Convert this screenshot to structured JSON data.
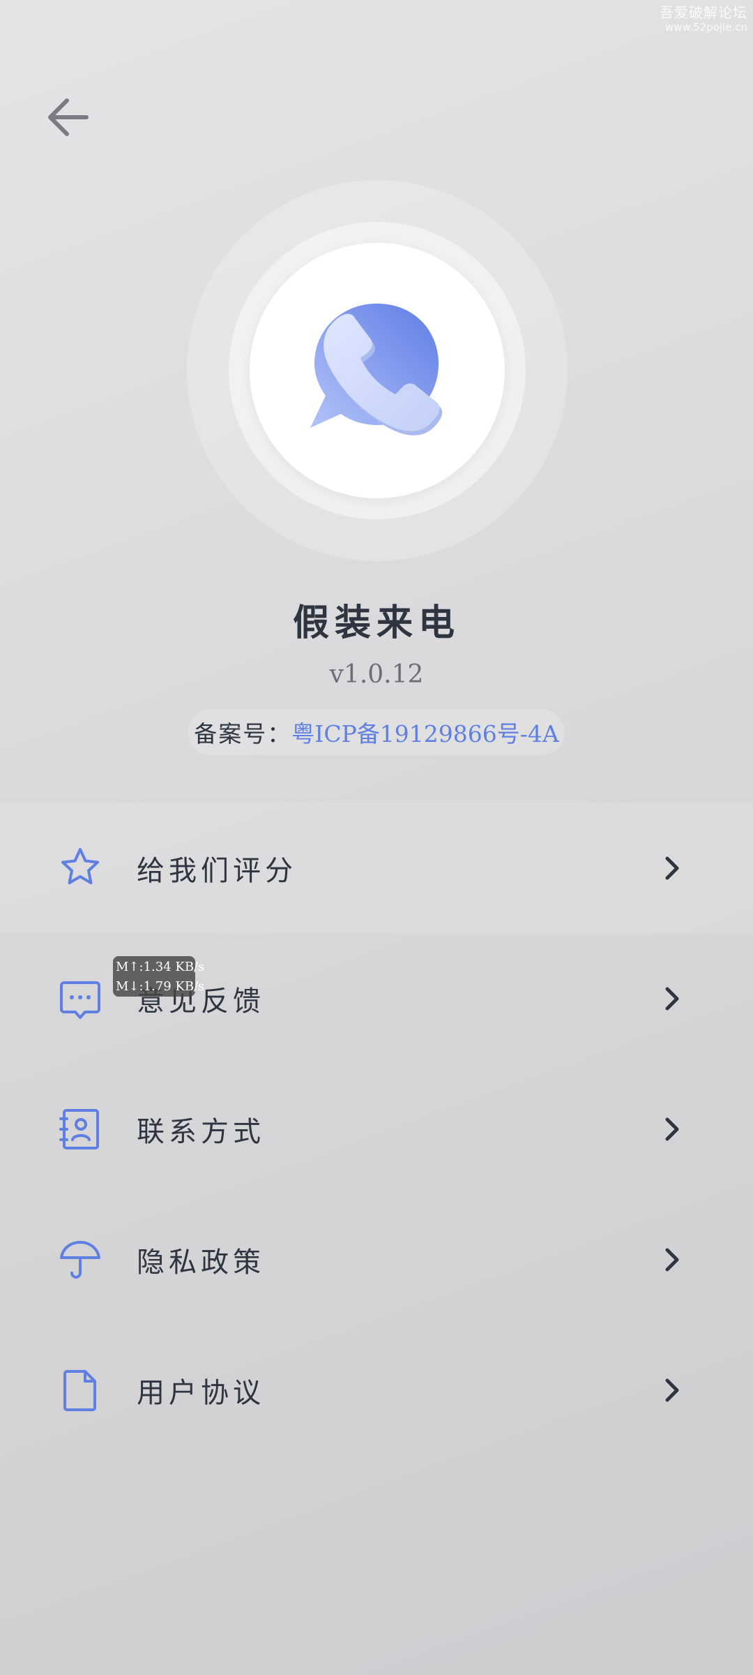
{
  "watermark": {
    "line1": "吾爱破解论坛",
    "line2": "www.52pojie.cn"
  },
  "header": {
    "back_icon": "arrow-left-icon"
  },
  "app": {
    "name": "假装来电",
    "version": "v1.0.12",
    "icp_label": "备案号：",
    "icp_value": "粤ICP备19129866号-4A",
    "logo_icon": "phone-chat-bubble-icon"
  },
  "menu": {
    "items": [
      {
        "label": "给我们评分",
        "icon": "star-icon"
      },
      {
        "label": "意见反馈",
        "icon": "chat-bubble-icon"
      },
      {
        "label": "联系方式",
        "icon": "contact-card-icon"
      },
      {
        "label": "隐私政策",
        "icon": "umbrella-icon"
      },
      {
        "label": "用户协议",
        "icon": "document-icon"
      }
    ]
  },
  "net_speed": {
    "up": "M↑:1.34 KB/s",
    "down": "M↓:1.79 KB/s"
  },
  "colors": {
    "accent": "#5f7fe3",
    "text": "#2e3440",
    "muted": "#6b6e76",
    "icon_gray": "#7a7c84"
  }
}
